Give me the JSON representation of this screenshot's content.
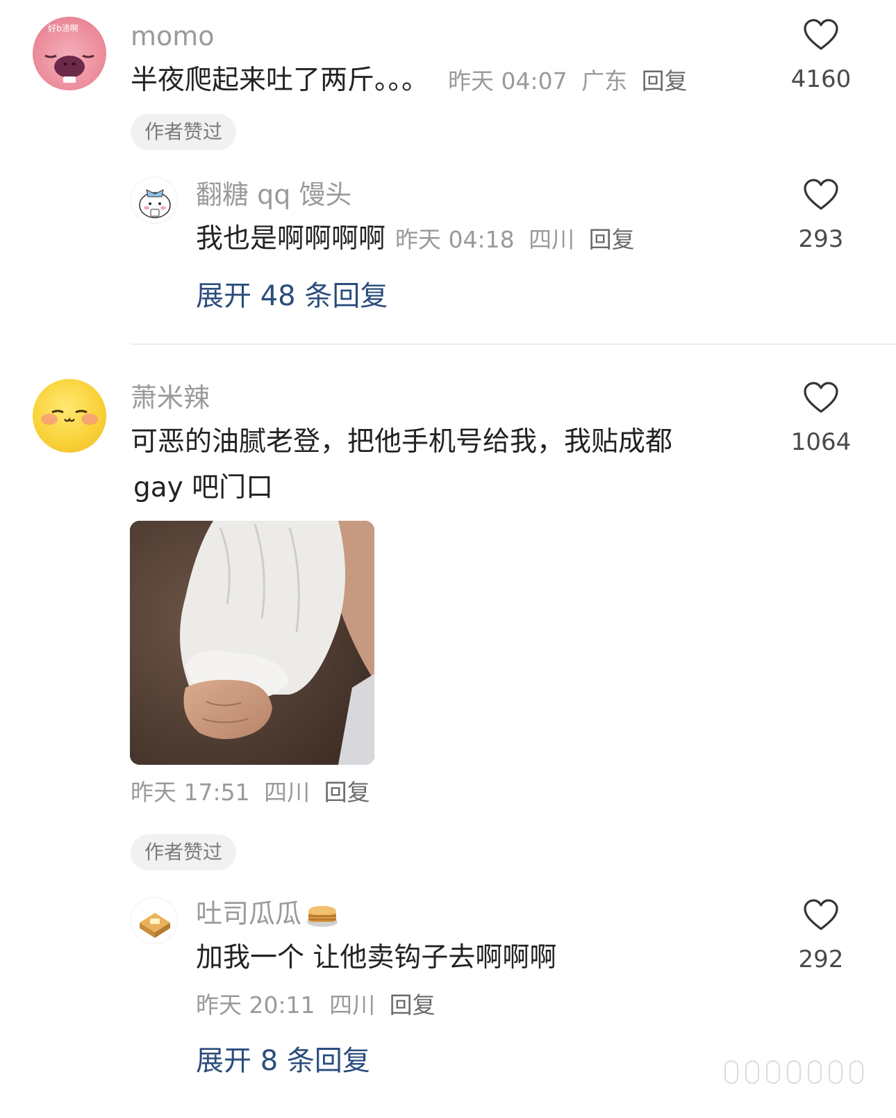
{
  "comments": [
    {
      "avatar_badge": "好b渍啊",
      "name": "momo",
      "text": "半夜爬起来吐了两斤。。。",
      "time": "昨天 04:07",
      "location": "广东",
      "reply_label": "回复",
      "likes": "4160",
      "author_liked": "作者赞过",
      "reply": {
        "name": "翻糖 qq 馒头",
        "text": "我也是啊啊啊啊",
        "time": "昨天 04:18",
        "location": "四川",
        "reply_label": "回复",
        "likes": "293"
      },
      "expand_label": "展开 48 条回复"
    },
    {
      "name": "萧米辣",
      "text_line1": "可恶的油腻老登，把他手机号给我，我贴成都",
      "text_line2": "gay 吧门口",
      "time": "昨天 17:51",
      "location": "四川",
      "reply_label": "回复",
      "likes": "1064",
      "author_liked": "作者赞过",
      "reply": {
        "name": "吐司瓜瓜",
        "text": "加我一个 让他卖钩子去啊啊啊",
        "time": "昨天 20:11",
        "location": "四川",
        "reply_label": "回复",
        "likes": "292"
      },
      "expand_label": "展开 8 条回复"
    }
  ],
  "icons": {
    "like": "heart-outline-icon",
    "watermark": "weibo-watermark-icon"
  },
  "colors": {
    "link_blue": "#2b4d7d",
    "meta_gray": "#9a9a9a"
  }
}
